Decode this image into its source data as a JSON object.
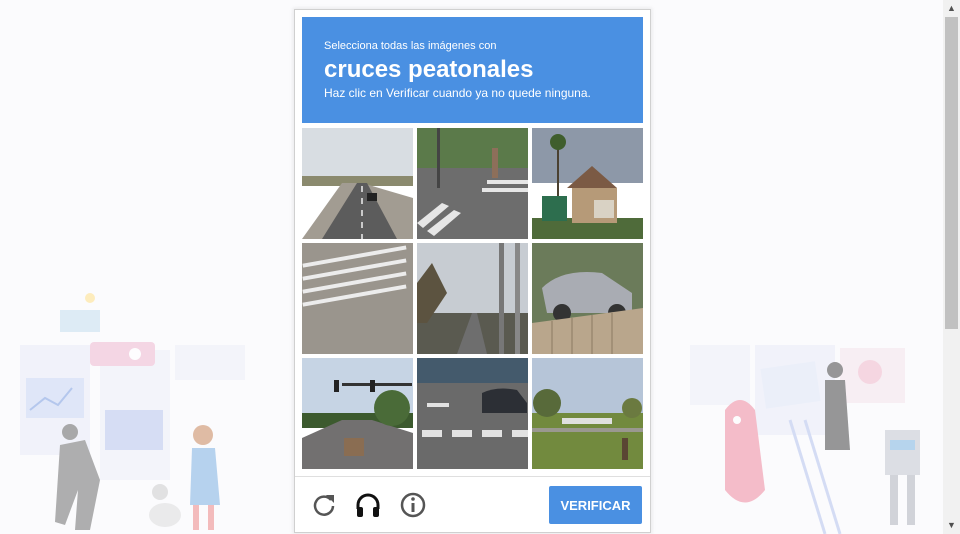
{
  "captcha": {
    "instruction": "Selecciona todas las imágenes con",
    "keyword": "cruces peatonales",
    "hint": "Haz clic en Verificar cuando ya no quede ninguna.",
    "tiles": [
      {
        "content": "highway-road"
      },
      {
        "content": "crosswalk-intersection"
      },
      {
        "content": "house-palm-tree"
      },
      {
        "content": "crosswalk-closeup"
      },
      {
        "content": "utility-poles-street"
      },
      {
        "content": "car-fence"
      },
      {
        "content": "traffic-light-road"
      },
      {
        "content": "crosswalk-car"
      },
      {
        "content": "grass-field-street"
      }
    ],
    "reload_icon": "reload-icon",
    "audio_icon": "headphones-icon",
    "info_icon": "info-icon",
    "verify_label": "VERIFICAR",
    "accent_color": "#4a90e2"
  }
}
